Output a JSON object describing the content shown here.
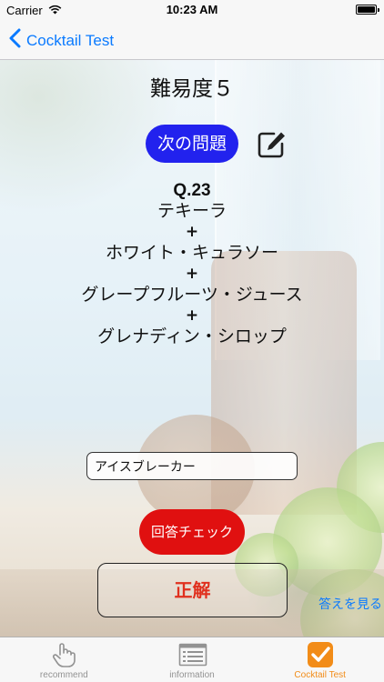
{
  "status_bar": {
    "carrier": "Carrier",
    "time": "10:23 AM",
    "wifi_icon": "wifi-icon",
    "battery_icon": "battery-icon",
    "battery_level": 1.0
  },
  "nav": {
    "back_label": "Cocktail Test",
    "back_icon": "chevron-left-icon"
  },
  "main": {
    "title": "難易度５",
    "next_button_label": "次の問題",
    "edit_icon": "edit-icon",
    "question": {
      "number": "Q.23",
      "plus": "+",
      "ingredients": [
        "テキーラ",
        "ホワイト・キュラソー",
        "グレープフルーツ・ジュース",
        "グレナディン・シロップ"
      ]
    },
    "answer_input_value": "アイスブレーカー",
    "check_button_label": "回答チェック",
    "result_text": "正解",
    "show_answer_label": "答えを見る"
  },
  "tab_bar": {
    "tabs": [
      {
        "label": "recommend",
        "icon": "hand-pointer-icon",
        "active": false
      },
      {
        "label": "information",
        "icon": "list-icon",
        "active": false
      },
      {
        "label": "Cocktail Test",
        "icon": "checkbox-icon",
        "active": true
      }
    ]
  },
  "colors": {
    "accent_blue": "#0a7aff",
    "next_button": "#2222ee",
    "check_button": "#e01010",
    "result_text": "#e0301e",
    "tab_active": "#f28c18",
    "tab_inactive": "#929292"
  }
}
